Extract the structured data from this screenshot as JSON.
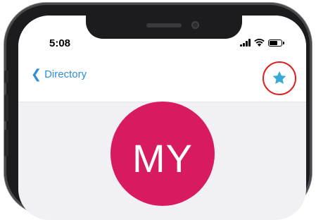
{
  "status_bar": {
    "time": "5:08",
    "signal_bars": 4,
    "battery_level": 0.7
  },
  "nav": {
    "back_label": "Directory",
    "back_icon": "chevron-left-icon",
    "favorite_icon": "star-icon",
    "accent_color": "#2f8ed8",
    "favorite_color": "#38a9d8",
    "highlight_color": "#e02020"
  },
  "profile": {
    "initials": "MY",
    "avatar_color": "#d81b60"
  }
}
